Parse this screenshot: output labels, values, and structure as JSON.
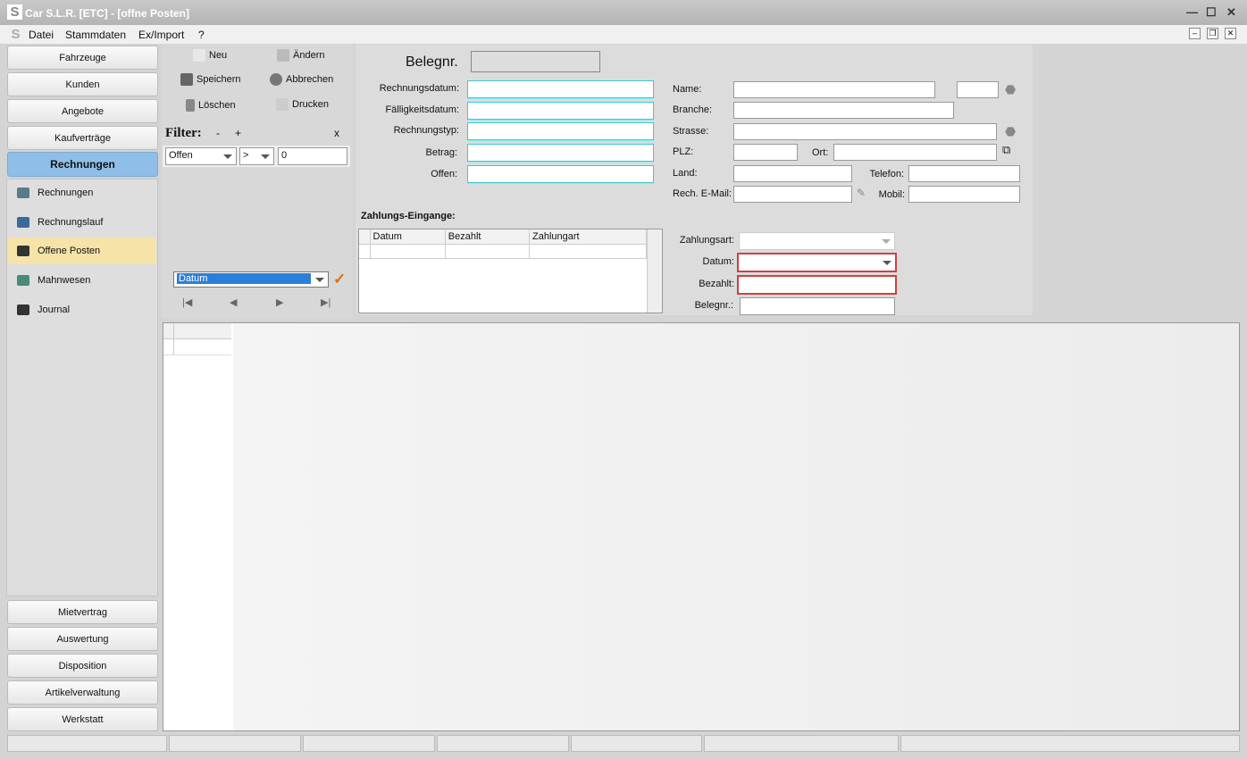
{
  "window": {
    "title": "Car S.L.R.  [ETC] - [offne Posten]"
  },
  "menu": [
    "Datei",
    "Stammdaten",
    "Ex/Import",
    "?"
  ],
  "nav_top": [
    "Fahrzeuge",
    "Kunden",
    "Angebote",
    "Kaufverträge",
    "Rechnungen"
  ],
  "nav_sub": [
    "Rechnungen",
    "Rechnungslauf",
    "Offene Posten",
    "Mahnwesen",
    "Journal"
  ],
  "nav_bottom": [
    "Mietvertrag",
    "Auswertung",
    "Disposition",
    "Artikelverwaltung",
    "Werkstatt"
  ],
  "toolbar": {
    "new": "Neu",
    "edit": "Ändern",
    "save": "Speichern",
    "cancel": "Abbrechen",
    "delete": "Löschen",
    "print": "Drucken"
  },
  "filter": {
    "label": "Filter:",
    "minus": "-",
    "plus": "+",
    "close": "x",
    "field": "Offen",
    "operator": ">",
    "value": "0"
  },
  "sort": {
    "field": "Datum"
  },
  "form": {
    "belegnr": "Belegnr.",
    "left": [
      "Rechnungsdatum:",
      "Fälligkeitsdatum:",
      "Rechnungstyp:",
      "Betrag:",
      "Offen:"
    ],
    "name": "Name:",
    "branche": "Branche:",
    "strasse": "Strasse:",
    "plz": "PLZ:",
    "ort": "Ort:",
    "land": "Land:",
    "telefon": "Telefon:",
    "email": "Rech. E-Mail:",
    "mobil": "Mobil:"
  },
  "payments": {
    "title": "Zahlungs-Eingange:",
    "columns": [
      "Datum",
      "Bezahlt",
      "Zahlungart"
    ],
    "zahlungsart": "Zahlungsart:",
    "datum": "Datum:",
    "bezahlt": "Bezahlt:",
    "belegnr": "Belegnr.:"
  },
  "colors": {
    "active_nav": "#8fbfe8",
    "selected_sub": "#f6e3a8",
    "required_border": "#d04040",
    "field_border": "#3cc8d2"
  }
}
